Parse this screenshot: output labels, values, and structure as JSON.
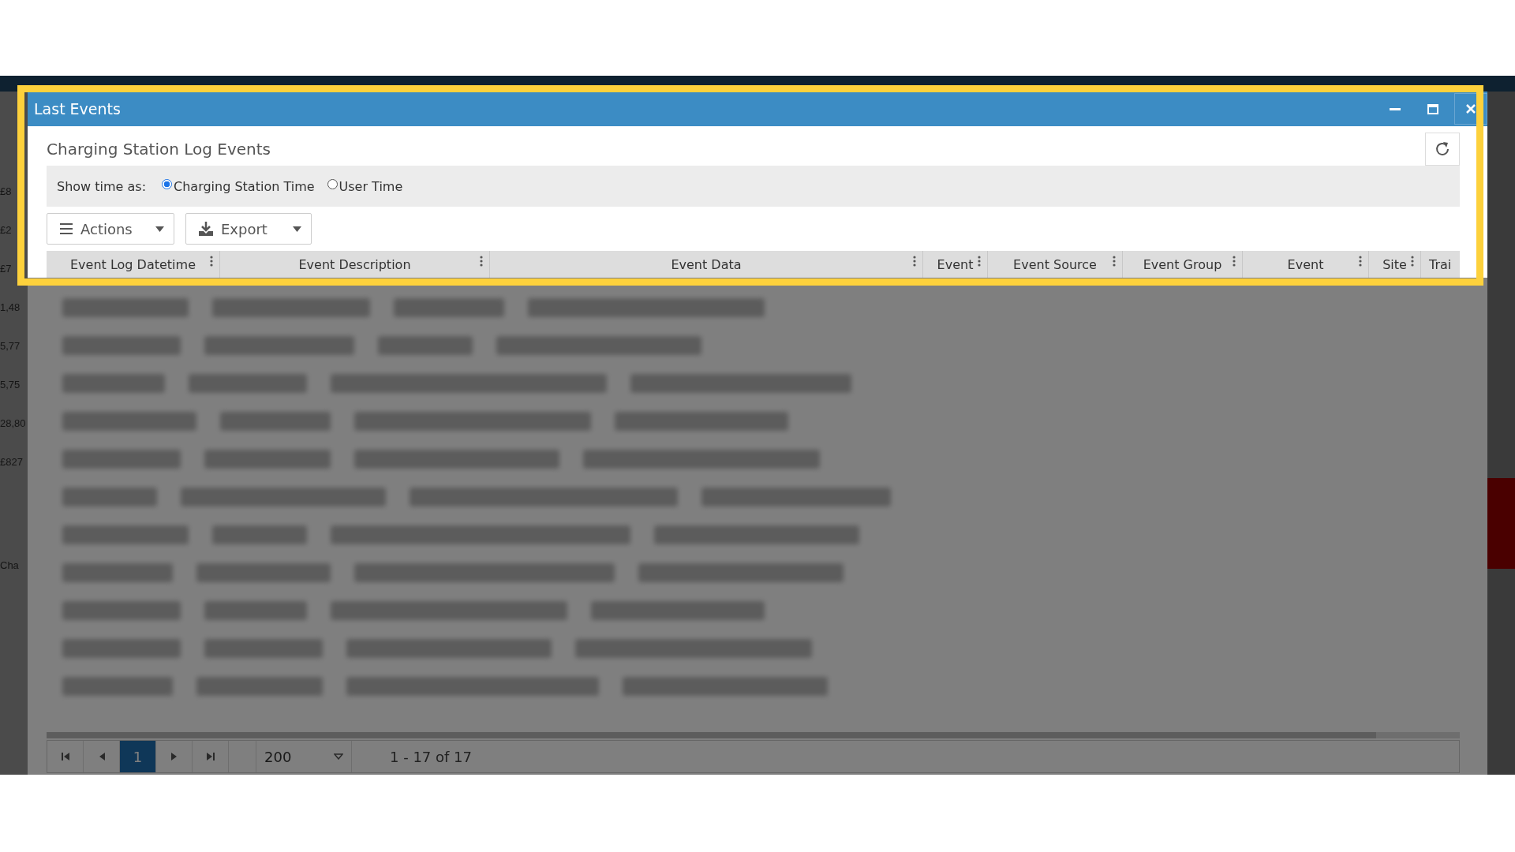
{
  "background": {
    "left_cells": [
      "£8",
      "£2",
      "£7",
      "1,48",
      "5,77",
      "5,75",
      "28,80",
      "£827",
      "Cha"
    ]
  },
  "dialog": {
    "title": "Last Events",
    "controls": [
      {
        "kind": "minimize"
      },
      {
        "kind": "maximize"
      },
      {
        "kind": "close"
      }
    ],
    "heading": "Charging Station Log Events",
    "time_mode": {
      "label": "Show time as:",
      "options": [
        {
          "label": "Charging Station Time",
          "selected": true
        },
        {
          "label": "User Time",
          "selected": false
        }
      ]
    },
    "toolbar": [
      {
        "label": "Actions",
        "kind": "menu"
      },
      {
        "label": "Export",
        "kind": "export"
      }
    ],
    "columns": [
      {
        "label": "Event Log Datetime"
      },
      {
        "label": "Event Description"
      },
      {
        "label": "Event Data"
      },
      {
        "label": "Event"
      },
      {
        "label": "Event Source"
      },
      {
        "label": "Event Group"
      },
      {
        "label": "Event"
      },
      {
        "label": "Site"
      },
      {
        "label": "Trai"
      }
    ],
    "pager": {
      "pages": [
        {
          "label": "1",
          "selected": true
        }
      ],
      "page_size": "200",
      "summary": "1 - 17 of 17"
    }
  }
}
